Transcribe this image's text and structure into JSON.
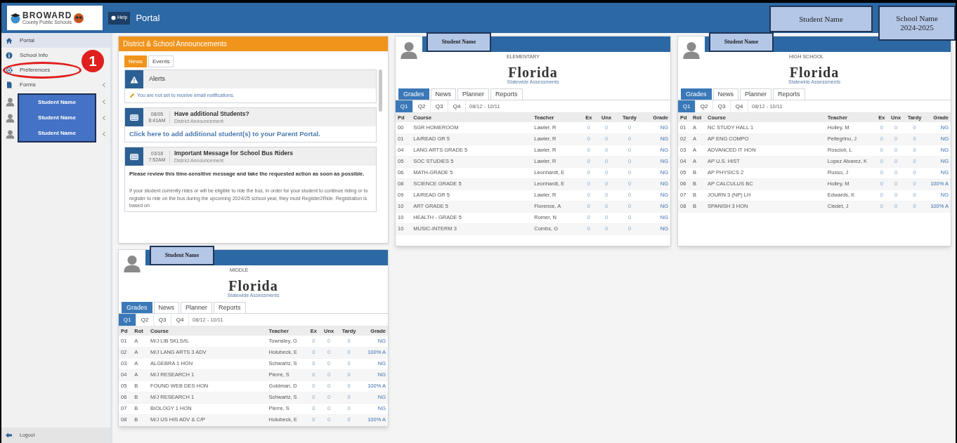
{
  "header": {
    "logo_name": "BROWARD",
    "logo_tagline": "County Public Schools",
    "help_button": "Help",
    "title": "Portal",
    "student_name_box": "Student Name",
    "school_name_box": [
      "School Name",
      "2024-2025"
    ]
  },
  "sidebar": {
    "items": [
      {
        "label": "Portal",
        "selected": true,
        "expandable": false
      },
      {
        "label": "School Info",
        "selected": false,
        "expandable": false
      },
      {
        "label": "Preferences",
        "selected": false,
        "expandable": false
      },
      {
        "label": "Forms",
        "selected": false,
        "expandable": true
      }
    ],
    "students": [
      "Student Name",
      "Student Name",
      "Student Name"
    ],
    "logout": "Logout"
  },
  "annotation": {
    "number": "1"
  },
  "announcements": {
    "title": "District & School Announcements",
    "tabs": [
      {
        "label": "News",
        "selected": true
      },
      {
        "label": "Events",
        "selected": false
      }
    ],
    "items": [
      {
        "kind": "alert",
        "title": "Alerts",
        "message": "You are not set to receive email notifications."
      },
      {
        "kind": "announcement",
        "date": "08/05",
        "time": "8:41AM",
        "title": "Have additional Students?",
        "source": "District Announcement",
        "link": "Click here to add additional student(s) to your Parent Portal."
      },
      {
        "kind": "announcement",
        "date": "03/18",
        "time": "7:52AM",
        "title": "Important Message for School Bus Riders",
        "source": "District Announcement",
        "lead": "Please review this time-sensitive message and take the requested action as soon as possible.",
        "body": "If your student currently rides or will be eligible to ride the bus, in order for your student to continue riding or to register to ride on the bus during the upcoming 2024/25 school year, they must Register2Ride.  Registration is based on"
      }
    ]
  },
  "cards": [
    {
      "student_box": "Student Name",
      "school": "ELEMENTARY",
      "logo_name": "Florida",
      "logo_tagline": "Statewide Assessments",
      "tabs": [
        {
          "label": "Grades",
          "selected": true
        },
        {
          "label": "News",
          "selected": false
        },
        {
          "label": "Planner",
          "selected": false
        },
        {
          "label": "Reports",
          "selected": false
        }
      ],
      "quarters": [
        {
          "label": "Q1",
          "selected": true
        },
        {
          "label": "Q2",
          "selected": false
        },
        {
          "label": "Q3",
          "selected": false
        },
        {
          "label": "Q4",
          "selected": false
        }
      ],
      "date_range": "08/12 - 10/11",
      "columns": [
        {
          "label": "Pd",
          "kind": "code"
        },
        {
          "label": "Course",
          "kind": "course"
        },
        {
          "label": "Teacher",
          "kind": "text"
        },
        {
          "label": "Ex",
          "kind": "count"
        },
        {
          "label": "Unx",
          "kind": "count"
        },
        {
          "label": "Tardy",
          "kind": "count"
        },
        {
          "label": "Grade",
          "kind": "grade"
        }
      ],
      "rows": [
        [
          "00",
          "SGR HOMEROOM",
          "Lawler, R",
          "0",
          "0",
          "0",
          "NG"
        ],
        [
          "01",
          "LA/READ GR 5",
          "Lawler, R",
          "0",
          "0",
          "0",
          "NG"
        ],
        [
          "04",
          "LANG ARTS GRADE 5",
          "Lawler, R",
          "0",
          "0",
          "0",
          "NG"
        ],
        [
          "05",
          "SOC STUDIES 5",
          "Lawler, R",
          "0",
          "0",
          "0",
          "NG"
        ],
        [
          "06",
          "MATH-GRADE 5",
          "Leonhardt, E",
          "0",
          "0",
          "0",
          "NG"
        ],
        [
          "08",
          "SCIENCE GRADE 5",
          "Leonhardt, E",
          "0",
          "0",
          "0",
          "NG"
        ],
        [
          "09",
          "LA/READ GR 5",
          "Lawler, R",
          "0",
          "0",
          "0",
          "NG"
        ],
        [
          "10",
          "ART GRADE 5",
          "Florence, A",
          "0",
          "0",
          "0",
          "NG"
        ],
        [
          "10",
          "HEALTH - GRADE 5",
          "Romer, N",
          "0",
          "0",
          "0",
          "NG"
        ],
        [
          "10",
          "MUSIC-INTERM 3",
          "Combs, G",
          "0",
          "0",
          "0",
          "NG"
        ]
      ]
    },
    {
      "student_box": "Student Name",
      "school": "HIGH SCHOOL",
      "logo_name": "Florida",
      "logo_tagline": "Statewide Assessments",
      "tabs": [
        {
          "label": "Grades",
          "selected": true
        },
        {
          "label": "News",
          "selected": false
        },
        {
          "label": "Planner",
          "selected": false
        },
        {
          "label": "Reports",
          "selected": false
        }
      ],
      "quarters": [
        {
          "label": "Q1",
          "selected": true
        },
        {
          "label": "Q2",
          "selected": false
        },
        {
          "label": "Q3",
          "selected": false
        },
        {
          "label": "Q4",
          "selected": false
        }
      ],
      "date_range": "08/12 - 10/11",
      "columns": [
        {
          "label": "Pd",
          "kind": "code"
        },
        {
          "label": "Rot",
          "kind": "code"
        },
        {
          "label": "Course",
          "kind": "course"
        },
        {
          "label": "Teacher",
          "kind": "text"
        },
        {
          "label": "Ex",
          "kind": "count"
        },
        {
          "label": "Unx",
          "kind": "count"
        },
        {
          "label": "Tardy",
          "kind": "count"
        },
        {
          "label": "Grade",
          "kind": "grade"
        }
      ],
      "rows": [
        [
          "01",
          "A",
          "NC STUDY HALL 1",
          "Holley, M",
          "0",
          "0",
          "0",
          "NG"
        ],
        [
          "02",
          "A",
          "AP ENG COMPO",
          "Pellegrino, J",
          "0",
          "0",
          "0",
          "NG"
        ],
        [
          "03",
          "A",
          "ADVANCED IT HON",
          "Roscioli, L",
          "0",
          "0",
          "0",
          "NG"
        ],
        [
          "04",
          "A",
          "AP U.S. HIST",
          "Lopez Alvarez, K",
          "0",
          "0",
          "0",
          "NG"
        ],
        [
          "05",
          "B",
          "AP PHYSICS 2",
          "Russo, J",
          "0",
          "0",
          "0",
          "NG"
        ],
        [
          "06",
          "B",
          "AP CALCULUS BC",
          "Holley, M",
          "0",
          "0",
          "0",
          "100% A"
        ],
        [
          "07",
          "B",
          "JOURN 3 (NP) LH",
          "Edwards, K",
          "0",
          "0",
          "0",
          "NG"
        ],
        [
          "08",
          "B",
          "SPANISH 3 HON",
          "Cledet, J",
          "0",
          "0",
          "0",
          "100% A"
        ]
      ]
    },
    {
      "student_box": "Student Name",
      "school": "MIDDLE",
      "logo_name": "Florida",
      "logo_tagline": "Statewide Assessments",
      "tabs": [
        {
          "label": "Grades",
          "selected": true
        },
        {
          "label": "News",
          "selected": false
        },
        {
          "label": "Planner",
          "selected": false
        },
        {
          "label": "Reports",
          "selected": false
        }
      ],
      "quarters": [
        {
          "label": "Q1",
          "selected": true
        },
        {
          "label": "Q2",
          "selected": false
        },
        {
          "label": "Q3",
          "selected": false
        },
        {
          "label": "Q4",
          "selected": false
        }
      ],
      "date_range": "08/12 - 10/11",
      "columns": [
        {
          "label": "Pd",
          "kind": "code"
        },
        {
          "label": "Rot",
          "kind": "code"
        },
        {
          "label": "Course",
          "kind": "course"
        },
        {
          "label": "Teacher",
          "kind": "text"
        },
        {
          "label": "Ex",
          "kind": "count"
        },
        {
          "label": "Unx",
          "kind": "count"
        },
        {
          "label": "Tardy",
          "kind": "count"
        },
        {
          "label": "Grade",
          "kind": "grade"
        }
      ],
      "rows": [
        [
          "01",
          "A",
          "M/J LIB SKLS/IL",
          "Townsley, G",
          "0",
          "0",
          "0",
          "NG"
        ],
        [
          "02",
          "A",
          "M/J LANG ARTS 3 ADV",
          "Holubeck, E",
          "0",
          "0",
          "0",
          "100% A"
        ],
        [
          "03",
          "A",
          "ALGEBRA 1 HON",
          "Schwartz, S",
          "0",
          "0",
          "0",
          "NG"
        ],
        [
          "04",
          "A",
          "M/J RESEARCH 1",
          "Pierre, S",
          "0",
          "0",
          "0",
          "NG"
        ],
        [
          "05",
          "B",
          "FOUND WEB DES HON",
          "Goldman, D",
          "0",
          "0",
          "0",
          "100% A"
        ],
        [
          "06",
          "B",
          "M/J RESEARCH 1",
          "Schwartz, S",
          "0",
          "0",
          "0",
          "NG"
        ],
        [
          "07",
          "B",
          "BIOLOGY 1 HON",
          "Pierre, S",
          "0",
          "0",
          "0",
          "NG"
        ],
        [
          "08",
          "B",
          "M/J US HIS ADV & C/P",
          "Holubeck, E",
          "0",
          "0",
          "0",
          "100% A"
        ]
      ]
    }
  ]
}
